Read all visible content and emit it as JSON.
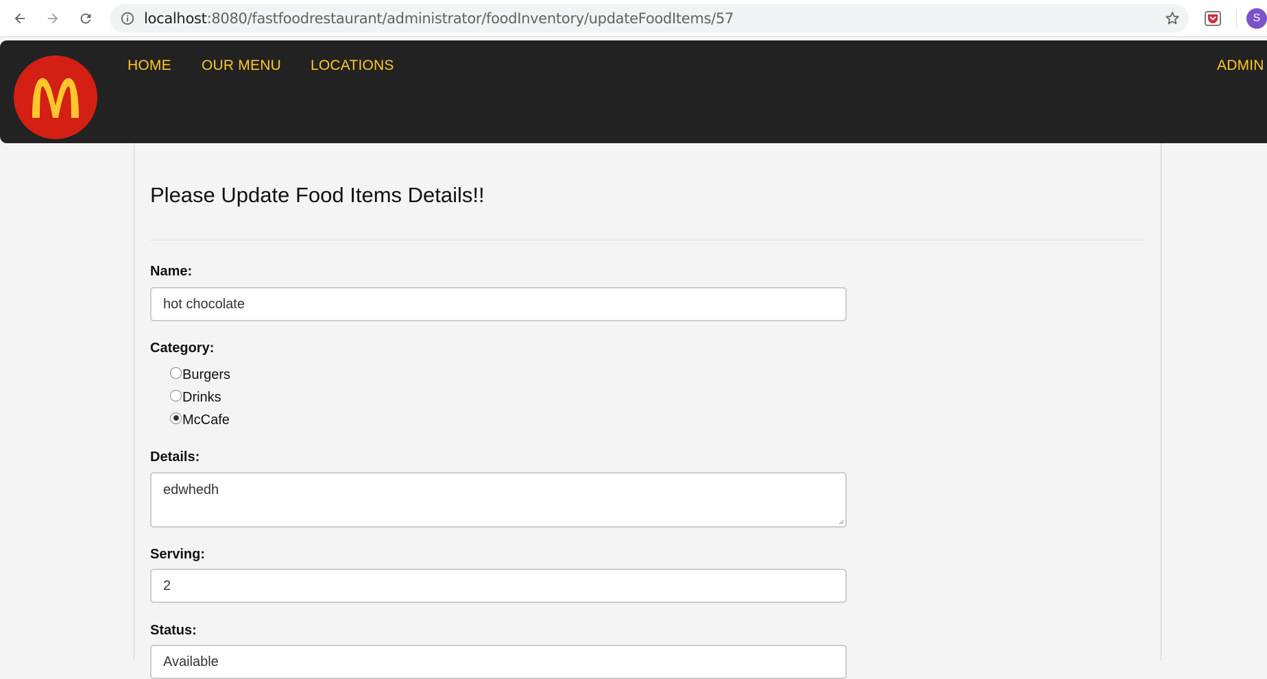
{
  "browser": {
    "url_host": "localhost",
    "url_rest": ":8080/fastfoodrestaurant/administrator/foodInventory/updateFoodItems/57",
    "profile_initial": "S"
  },
  "navbar": {
    "logo_icon": "golden-arches-logo",
    "brand_color": "#d31f14",
    "accent_color": "#ffc72c",
    "links": [
      "HOME",
      "OUR MENU",
      "LOCATIONS"
    ],
    "admin_label": "ADMIN"
  },
  "form": {
    "title": "Please Update Food Items Details!!",
    "name_label": "Name:",
    "name_value": "hot chocolate",
    "category_label": "Category:",
    "categories": [
      {
        "label": "Burgers",
        "checked": false
      },
      {
        "label": "Drinks",
        "checked": false
      },
      {
        "label": "McCafe",
        "checked": true
      }
    ],
    "details_label": "Details:",
    "details_value": "edwhedh",
    "serving_label": "Serving:",
    "serving_value": "2",
    "status_label": "Status:",
    "status_value": "Available"
  }
}
